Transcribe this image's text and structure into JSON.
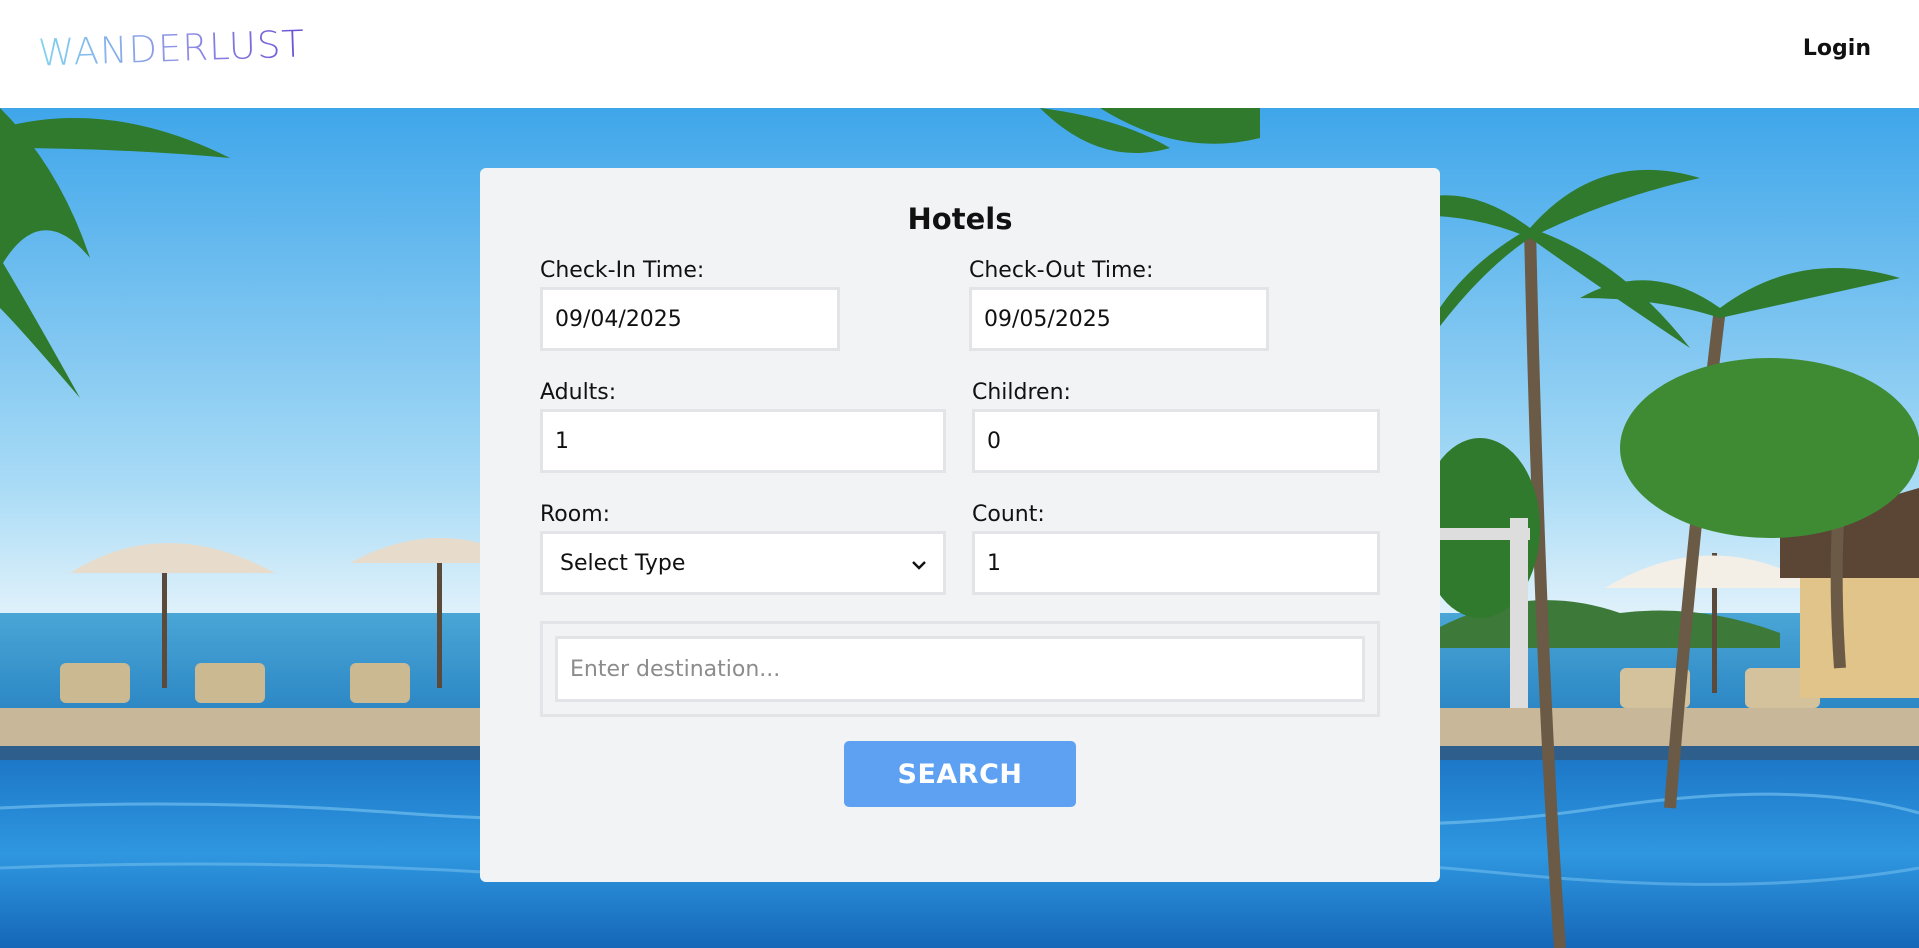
{
  "header": {
    "logo": "WANDERLUST",
    "login_label": "Login"
  },
  "form": {
    "title": "Hotels",
    "check_in_label": "Check-In Time:",
    "check_in_value": "09/04/2025",
    "check_out_label": "Check-Out Time:",
    "check_out_value": "09/05/2025",
    "adults_label": "Adults:",
    "adults_value": "1",
    "children_label": "Children:",
    "children_value": "0",
    "room_label": "Room:",
    "room_selected": "Select Type",
    "count_label": "Count:",
    "count_value": "1",
    "destination_placeholder": "Enter destination...",
    "search_label": "SEARCH"
  },
  "colors": {
    "accent": "#5ea1f2",
    "card_bg": "#f2f3f5",
    "logo_gradient_start": "#7fd3ef",
    "logo_gradient_end": "#6a4fd6"
  },
  "icons": {
    "room_dropdown": "chevron-down-icon"
  }
}
